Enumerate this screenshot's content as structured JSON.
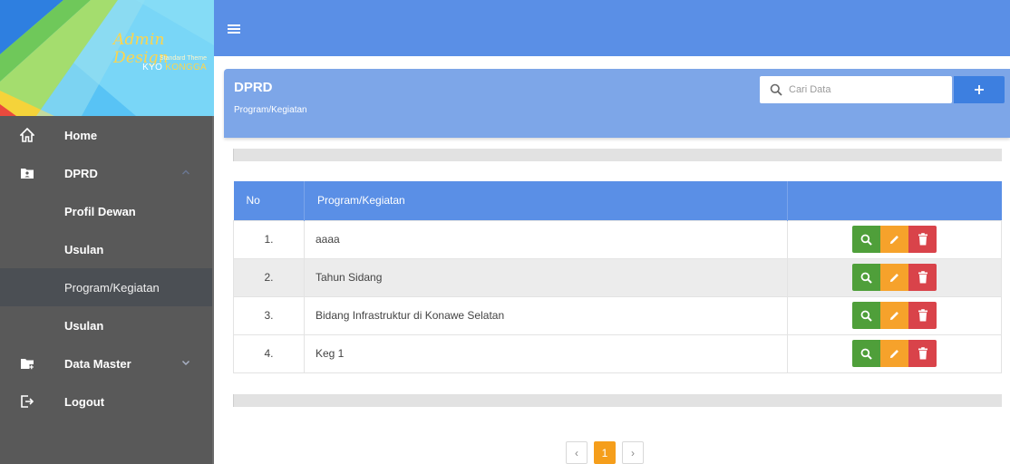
{
  "brand": {
    "title": "Admin Design",
    "subtitle": "Standard Theme",
    "author_first": "KYO",
    "author_second": "KONGGA"
  },
  "sidebar": {
    "items": [
      {
        "label": "Home",
        "icon": "home-icon"
      },
      {
        "label": "DPRD",
        "icon": "folder-user-icon",
        "expanded": true,
        "children": [
          {
            "label": "Profil Dewan"
          },
          {
            "label": "Usulan"
          },
          {
            "label": "Program/Kegiatan",
            "active": true
          },
          {
            "label": "Usulan"
          }
        ]
      },
      {
        "label": "Data Master",
        "icon": "folder-add-icon",
        "expanded": false
      },
      {
        "label": "Logout",
        "icon": "logout-icon"
      }
    ]
  },
  "header": {
    "title": "DPRD",
    "subtitle": "Program/Kegiatan"
  },
  "search": {
    "placeholder": "Cari Data",
    "value": ""
  },
  "table": {
    "columns": [
      "No",
      "Program/Kegiatan",
      ""
    ],
    "rows": [
      {
        "no": "1.",
        "name": "aaaa"
      },
      {
        "no": "2.",
        "name": "Tahun Sidang"
      },
      {
        "no": "3.",
        "name": "Bidang Infrastruktur di Konawe Selatan"
      },
      {
        "no": "4.",
        "name": "Keg 1"
      }
    ]
  },
  "pagination": {
    "prev": "‹",
    "current": "1",
    "next": "›"
  },
  "colors": {
    "topbar": "#5a8fe6",
    "header": "#7da6e8",
    "sidebar": "#595959",
    "view": "#4f9f3a",
    "edit": "#f6a22b",
    "delete": "#d9434a",
    "page_active": "#f59e1b"
  }
}
